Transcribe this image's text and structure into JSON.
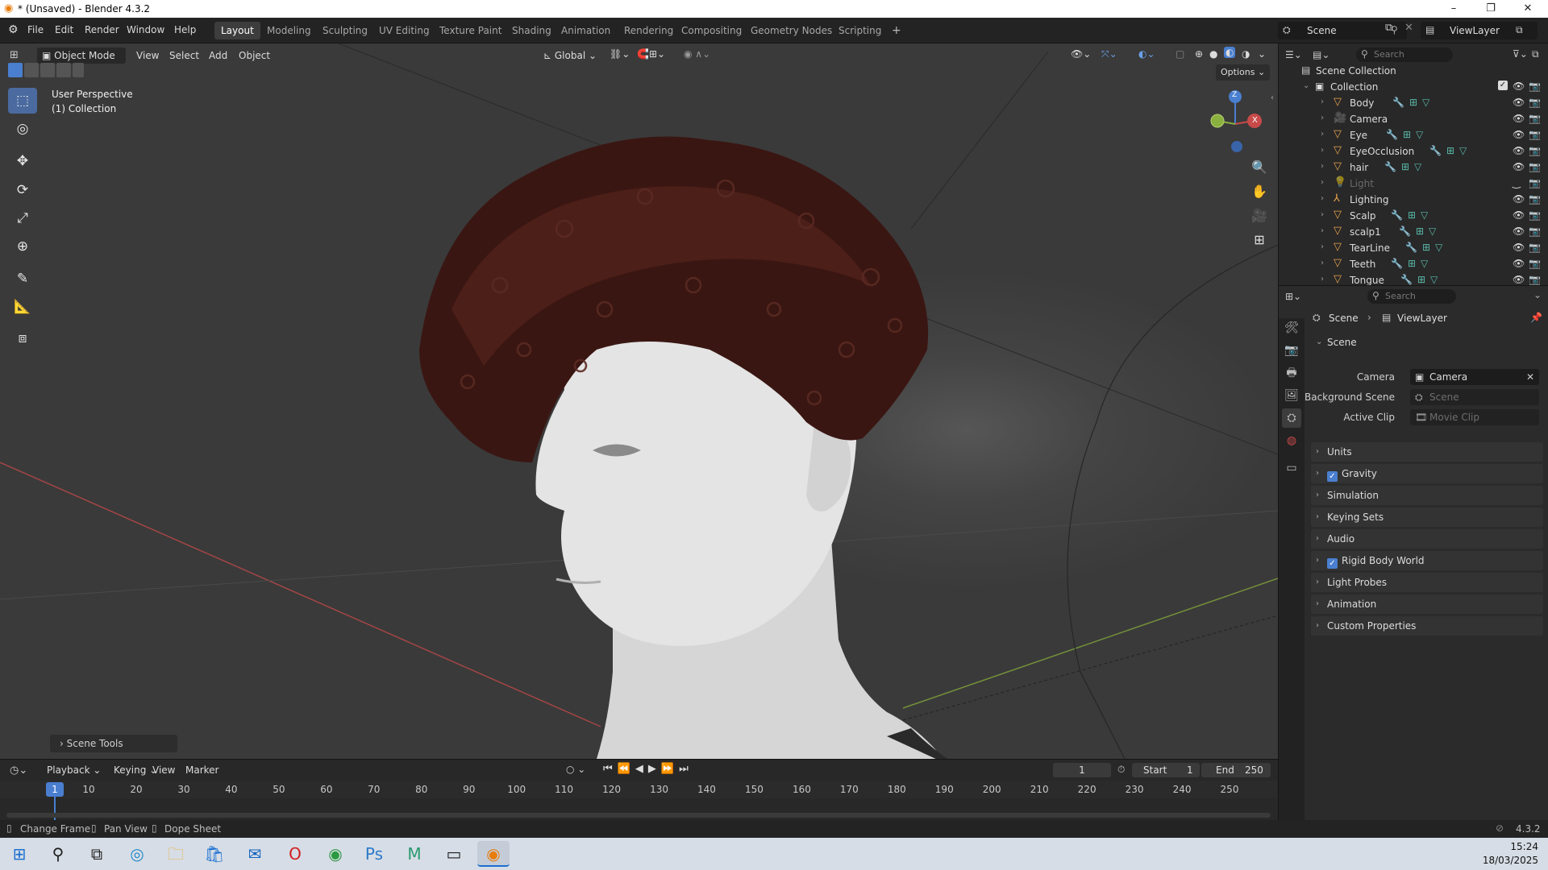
{
  "window": {
    "title": "* (Unsaved) - Blender 4.3.2",
    "controls": [
      "–",
      "❐",
      "✕"
    ]
  },
  "menubar": {
    "menus": [
      "File",
      "Edit",
      "Render",
      "Window",
      "Help"
    ],
    "workspaces": [
      "Layout",
      "Modeling",
      "Sculpting",
      "UV Editing",
      "Texture Paint",
      "Shading",
      "Animation",
      "Rendering",
      "Compositing",
      "Geometry Nodes",
      "Scripting"
    ],
    "active_workspace": "Layout",
    "add_workspace": "+",
    "scene_name": "Scene",
    "viewlayer_name": "ViewLayer"
  },
  "viewport": {
    "mode": "Object Mode",
    "menus": [
      "View",
      "Select",
      "Add",
      "Object"
    ],
    "orientation": "Global",
    "options_label": "Options",
    "overlay_title": "User Perspective",
    "overlay_collection": "(1) Collection",
    "scene_tools_label": "Scene Tools",
    "gizmo": {
      "z": "Z",
      "x": "X"
    }
  },
  "timeline": {
    "menus": [
      "Playback",
      "Keying",
      "View",
      "Marker"
    ],
    "current_frame": "1",
    "start_label": "Start",
    "start_value": "1",
    "end_label": "End",
    "end_value": "250",
    "ticks": [
      "10",
      "20",
      "30",
      "40",
      "50",
      "60",
      "70",
      "80",
      "90",
      "100",
      "110",
      "120",
      "130",
      "140",
      "150",
      "160",
      "170",
      "180",
      "190",
      "200",
      "210",
      "220",
      "230",
      "240",
      "250"
    ],
    "frame_marker": "1"
  },
  "statusbar": {
    "hints": [
      "Change Frame",
      "Pan View",
      "Dope Sheet"
    ],
    "version": "4.3.2"
  },
  "outliner": {
    "search_placeholder": "Search",
    "scene_collection": "Scene Collection",
    "collection": "Collection",
    "items": [
      {
        "name": "Body",
        "icon": "mesh-icon"
      },
      {
        "name": "Camera",
        "icon": "camera-icon"
      },
      {
        "name": "Eye",
        "icon": "mesh-icon"
      },
      {
        "name": "EyeOcclusion",
        "icon": "mesh-icon"
      },
      {
        "name": "hair",
        "icon": "mesh-icon"
      },
      {
        "name": "Light",
        "icon": "light-icon"
      },
      {
        "name": "Lighting",
        "icon": "armature-icon"
      },
      {
        "name": "Scalp",
        "icon": "mesh-icon"
      },
      {
        "name": "scalp1",
        "icon": "mesh-icon"
      },
      {
        "name": "TearLine",
        "icon": "mesh-icon"
      },
      {
        "name": "Teeth",
        "icon": "mesh-icon"
      },
      {
        "name": "Tongue",
        "icon": "mesh-icon"
      }
    ]
  },
  "properties": {
    "search_placeholder": "Search",
    "breadcrumb": [
      "Scene",
      "ViewLayer"
    ],
    "scene_panel": "Scene",
    "camera_label": "Camera",
    "camera_value": "Camera",
    "background_scene_label": "Background Scene",
    "background_scene_placeholder": "Scene",
    "active_clip_label": "Active Clip",
    "active_clip_placeholder": "Movie Clip",
    "panels": [
      {
        "label": "Units",
        "checkbox": false
      },
      {
        "label": "Gravity",
        "checkbox": true
      },
      {
        "label": "Simulation",
        "checkbox": false
      },
      {
        "label": "Keying Sets",
        "checkbox": false
      },
      {
        "label": "Audio",
        "checkbox": false
      },
      {
        "label": "Rigid Body World",
        "checkbox": true
      },
      {
        "label": "Light Probes",
        "checkbox": false
      },
      {
        "label": "Animation",
        "checkbox": false
      },
      {
        "label": "Custom Properties",
        "checkbox": false
      }
    ]
  },
  "taskbar": {
    "time": "15:24",
    "date": "18/03/2025"
  }
}
